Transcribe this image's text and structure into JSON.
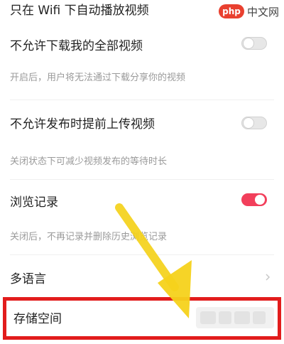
{
  "settings": {
    "wifi_autoplay": {
      "label": "只在 Wifi 下自动播放视频"
    },
    "disallow_download": {
      "label": "不允许下载我的全部视频",
      "description": "开启后，用户将无法通过下载分享你的视频",
      "enabled": false
    },
    "disallow_preupload": {
      "label": "不允许发布时提前上传视频",
      "description": "关闭状态下可减少视频发布的等待时长",
      "enabled": false
    },
    "browse_history": {
      "label": "浏览记录",
      "description": "关闭后，不再记录并删除历史浏览记录",
      "enabled": true
    },
    "multi_language": {
      "label": "多语言"
    },
    "storage": {
      "label": "存储空间"
    }
  },
  "watermark": {
    "logo": "php",
    "text": "中文网"
  },
  "colors": {
    "accent": "#f23f5b",
    "highlight_border": "#e21c1c",
    "arrow": "#f5d21b"
  },
  "icons": {
    "switch_off": "toggle-off-icon",
    "switch_on": "toggle-on-icon",
    "chevron": "chevron-right-icon",
    "annotation_arrow": "arrow-pointer-icon"
  }
}
